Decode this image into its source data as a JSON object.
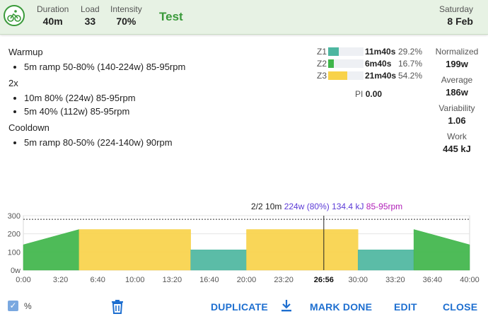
{
  "header": {
    "logo_icon": "cyclist-icon",
    "stats": [
      {
        "label": "Duration",
        "value": "40m"
      },
      {
        "label": "Load",
        "value": "33"
      },
      {
        "label": "Intensity",
        "value": "70%"
      }
    ],
    "title": "Test",
    "day": "Saturday",
    "date": "8 Feb"
  },
  "steps": [
    {
      "heading": "Warmup",
      "items": [
        "5m ramp 50-80% (140-224w) 85-95rpm"
      ]
    },
    {
      "heading": "2x",
      "items": [
        "10m 80% (224w) 85-95rpm",
        "5m 40% (112w) 85-95rpm"
      ]
    },
    {
      "heading": "Cooldown",
      "items": [
        "5m ramp 80-50% (224-140w) 90rpm"
      ]
    }
  ],
  "zones": [
    {
      "name": "Z1",
      "time": "11m40s",
      "percent": "29.2%",
      "fraction": 0.292,
      "color": "#4db6a0"
    },
    {
      "name": "Z2",
      "time": "6m40s",
      "percent": "16.7%",
      "fraction": 0.167,
      "color": "#3fb54a"
    },
    {
      "name": "Z3",
      "time": "21m40s",
      "percent": "54.2%",
      "fraction": 0.542,
      "color": "#f8d24a"
    }
  ],
  "pi": {
    "label": "PI",
    "value": "0.00"
  },
  "metrics": [
    {
      "label": "Normalized",
      "value": "199w"
    },
    {
      "label": "Average",
      "value": "186w"
    },
    {
      "label": "Variability",
      "value": "1.06"
    },
    {
      "label": "Work",
      "value": "445 kJ"
    }
  ],
  "hover": {
    "step": "2/2 10m",
    "power": "224w (80%)",
    "work": "134.4 kJ",
    "cadence": "85-95rpm"
  },
  "chart_data": {
    "type": "area",
    "x_unit": "minutes",
    "ylim": [
      0,
      300
    ],
    "yticks": [
      "0w",
      "100",
      "200",
      "300"
    ],
    "xticks": [
      "0:00",
      "3:20",
      "6:40",
      "10:00",
      "13:20",
      "16:40",
      "20:00",
      "23:20",
      "26:56",
      "30:00",
      "33:20",
      "36:40",
      "40:00"
    ],
    "ftp_line": 280,
    "cursor_x": 26.93,
    "segments": [
      {
        "start": 0,
        "end": 5,
        "from": 140,
        "to": 224,
        "color": "#3fb54a"
      },
      {
        "start": 5,
        "end": 15,
        "from": 224,
        "to": 224,
        "color": "#f8d24a"
      },
      {
        "start": 15,
        "end": 20,
        "from": 112,
        "to": 112,
        "color": "#4db6a0"
      },
      {
        "start": 20,
        "end": 30,
        "from": 224,
        "to": 224,
        "color": "#f8d24a"
      },
      {
        "start": 30,
        "end": 35,
        "from": 112,
        "to": 112,
        "color": "#4db6a0"
      },
      {
        "start": 35,
        "end": 40,
        "from": 224,
        "to": 140,
        "color": "#3fb54a"
      }
    ]
  },
  "footer": {
    "percent_label": "%",
    "duplicate": "DUPLICATE",
    "mark_done": "MARK DONE",
    "edit": "EDIT",
    "close": "CLOSE"
  }
}
